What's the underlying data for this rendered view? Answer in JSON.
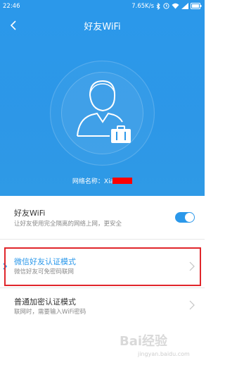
{
  "status_bar": {
    "time": "22:46",
    "speed": "7.65K/s"
  },
  "header": {
    "title": "好友WiFi"
  },
  "hero": {
    "network_label": "网络名称：",
    "network_value": "Xia"
  },
  "settings": [
    {
      "title": "好友WiFi",
      "desc": "让好友使用完全隔离的网络上网，更安全",
      "control": "toggle",
      "checked": true
    },
    {
      "title": "微信好友认证模式",
      "desc": "微信好友可免密码联网",
      "control": "chevron",
      "selected": true
    },
    {
      "title": "普通加密认证模式",
      "desc": "联网时，需要输入WiFi密码",
      "control": "chevron"
    }
  ],
  "watermark": {
    "brand": "Bai经验",
    "url": "jingyan.baidu.com"
  },
  "colors": {
    "primary": "#2b98ea",
    "highlight": "#e0262b",
    "selected_text": "#2b98ea"
  }
}
